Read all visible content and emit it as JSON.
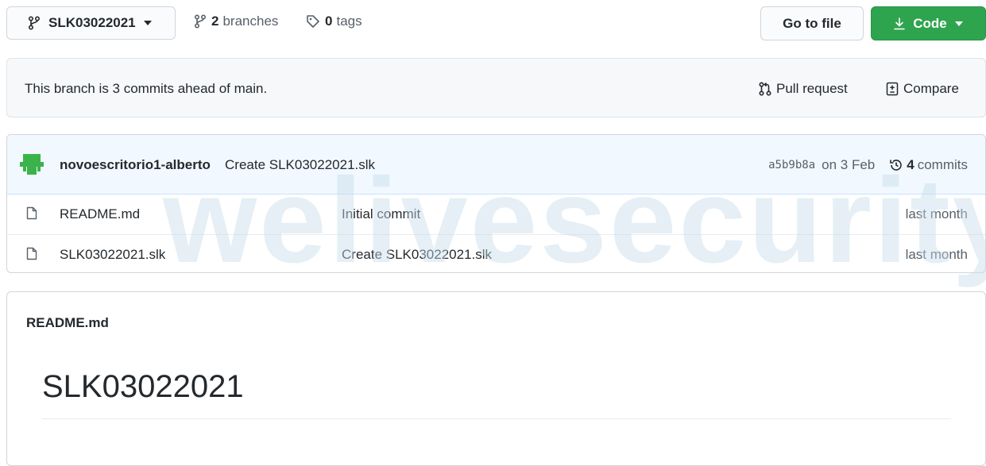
{
  "toolbar": {
    "branch_name": "SLK03022021",
    "branches_count": "2",
    "branches_label": "branches",
    "tags_count": "0",
    "tags_label": "tags",
    "goto_file_label": "Go to file",
    "code_label": "Code"
  },
  "ahead_banner": {
    "text": "This branch is 3 commits ahead of main.",
    "pull_request_label": "Pull request",
    "compare_label": "Compare"
  },
  "latest_commit": {
    "author": "novoescritorio1-alberto",
    "message": "Create SLK03022021.slk",
    "sha": "a5b9b8a",
    "date": "on 3 Feb",
    "commits_count": "4",
    "commits_label": "commits"
  },
  "files": [
    {
      "name": "README.md",
      "commit_message": "Initial commit",
      "age": "last month"
    },
    {
      "name": "SLK03022021.slk",
      "commit_message": "Create SLK03022021.slk",
      "age": "last month"
    }
  ],
  "readme": {
    "filename": "README.md",
    "heading": "SLK03022021"
  },
  "watermark_text": "welivesecurity",
  "colors": {
    "accent_green": "#2ea44f",
    "commit_row_bg": "#f1f8ff",
    "text_primary": "#24292e",
    "text_muted": "#586069"
  }
}
